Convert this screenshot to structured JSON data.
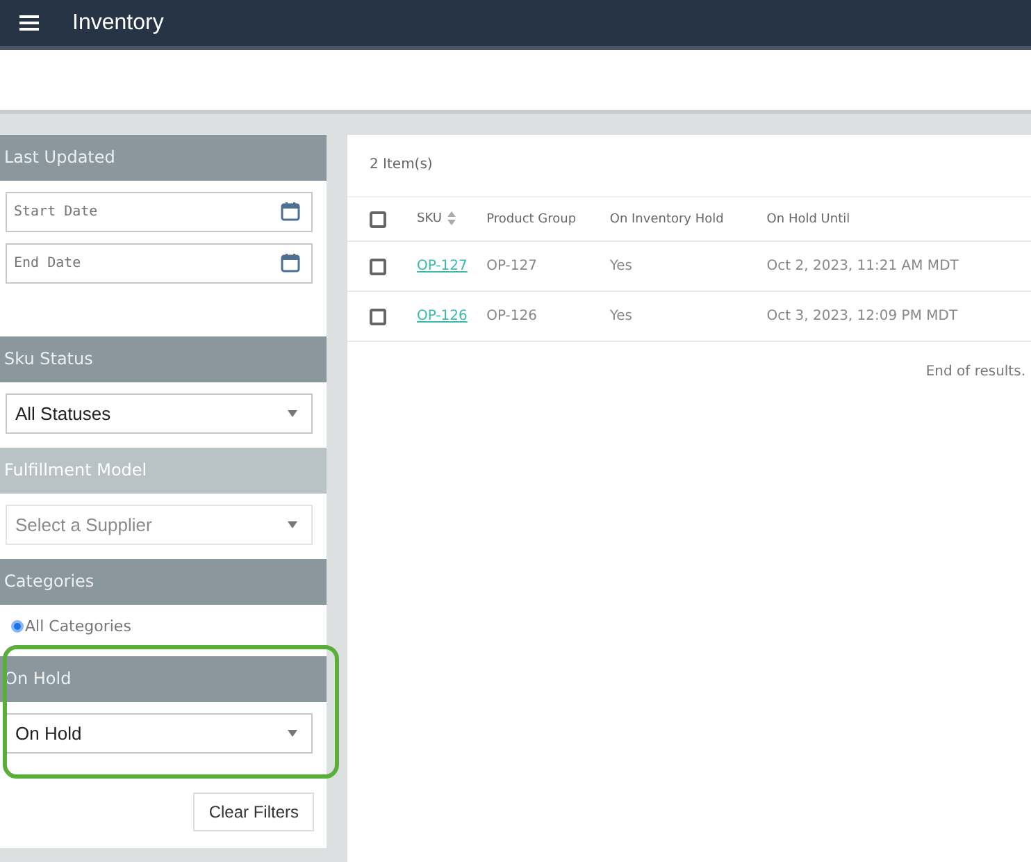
{
  "app_bar": {
    "title": "Inventory"
  },
  "filters": [
    {
      "kind": "dates",
      "title": "Last Updated",
      "obscured": false,
      "highlighted": false,
      "fields": [
        {
          "placeholder": "Start Date"
        },
        {
          "placeholder": "End Date"
        }
      ]
    },
    {
      "kind": "select",
      "title": "Sku Status",
      "obscured": false,
      "highlighted": false,
      "value": "All Statuses"
    },
    {
      "kind": "select",
      "title": "Fulfillment Model",
      "obscured": true,
      "highlighted": false,
      "placeholder": "Select a Supplier"
    },
    {
      "kind": "radio",
      "title": "Categories",
      "obscured": false,
      "highlighted": false,
      "options": [
        {
          "label": "All Categories",
          "selected": true
        }
      ]
    },
    {
      "kind": "select",
      "title": "On Hold",
      "obscured": false,
      "highlighted": true,
      "value": "On Hold"
    }
  ],
  "clear_button": "Clear Filters",
  "results": {
    "count": "2 Item(s)",
    "all_checked": false,
    "columns": [
      {
        "label": "SKU",
        "sortable": true
      },
      {
        "label": "Product Group",
        "sortable": false
      },
      {
        "label": "On Inventory Hold",
        "sortable": false
      },
      {
        "label": "On Hold Until",
        "sortable": false
      }
    ],
    "rows": [
      {
        "checked": false,
        "sku": "OP-127",
        "product_group": "OP-127",
        "on_hold": "Yes",
        "until": "Oct 2, 2023, 11:21 AM MDT"
      },
      {
        "checked": false,
        "sku": "OP-126",
        "product_group": "OP-126",
        "on_hold": "Yes",
        "until": "Oct 3, 2023, 12:09 PM MDT"
      }
    ],
    "footer": "End of results."
  }
}
